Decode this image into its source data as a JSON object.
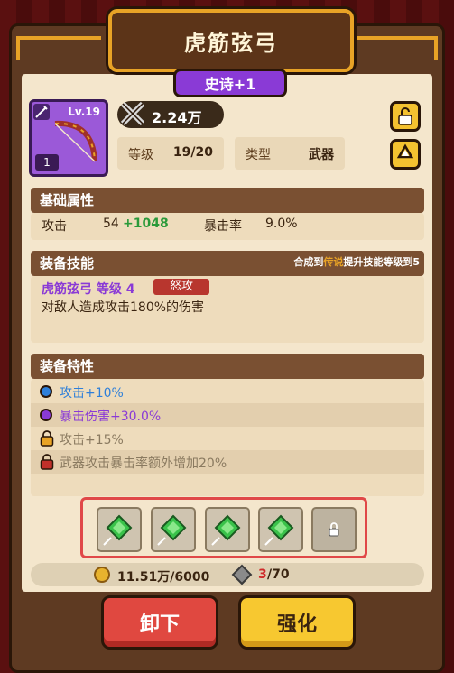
{
  "title": "虎筋弦弓",
  "rarity_label": "史诗+1",
  "item": {
    "level": "Lv.19",
    "count": "1",
    "icon": "bow-icon"
  },
  "power": "2.24万",
  "stats": {
    "level_label": "等级",
    "level_value": "19/20",
    "type_label": "类型",
    "type_value": "武器"
  },
  "basic": {
    "header": "基础属性",
    "attack_label": "攻击",
    "attack_base": "54",
    "attack_bonus": "+1048",
    "crit_label": "暴击率",
    "crit_value": "9.0%"
  },
  "skill": {
    "header": "装备技能",
    "hint_prefix": "合成到",
    "hint_hl": "传说",
    "hint_suffix": "提升技能等级到5",
    "name": "虎筋弦弓 等级 4",
    "tag": "怒攻",
    "desc": "对敌人造成攻击180%的伤害"
  },
  "traits": {
    "header": "装备特性",
    "items": [
      {
        "text": "攻击+10%",
        "color": "#2e7fd9",
        "status": "unlocked"
      },
      {
        "text": "暴击伤害+30.0%",
        "color": "#8a3ad6",
        "status": "unlocked"
      },
      {
        "text": "攻击+15%",
        "color": "#e8a326",
        "status": "locked"
      },
      {
        "text": "武器攻击暴击率额外增加20%",
        "color": "#c0302a",
        "status": "locked"
      }
    ]
  },
  "resources": {
    "coins": "11.51万/6000",
    "ore_have": "3",
    "ore_need": "/70"
  },
  "buttons": {
    "unequip": "卸下",
    "upgrade": "强化"
  },
  "colors": {
    "accent": "#e8a326",
    "epic": "#8a3ad6",
    "positive": "#2a9a3a"
  }
}
